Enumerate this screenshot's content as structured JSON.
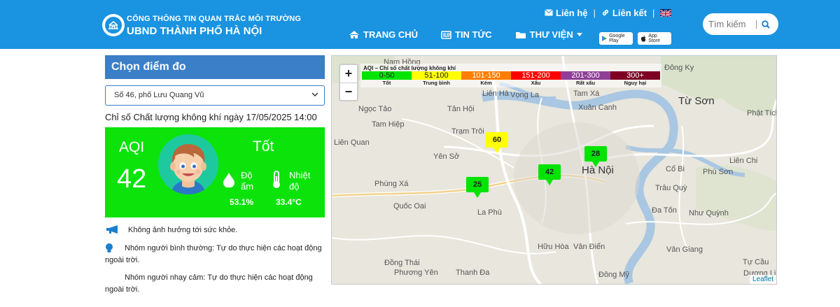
{
  "header": {
    "brand_top": "CỔNG THÔNG TIN QUAN TRẮC MÔI TRƯỜNG",
    "brand_main": "UBND THÀNH PHỐ HÀ NỘI",
    "contact": "Liên hệ",
    "links": "Liên kết",
    "nav": [
      {
        "label": "TRANG CHỦ",
        "icon": "home-icon"
      },
      {
        "label": "TIN TỨC",
        "icon": "newspaper-icon"
      },
      {
        "label": "THƯ VIỆN",
        "icon": "folder-icon"
      }
    ],
    "google_play": "Google Play",
    "app_store": "App Store",
    "search_placeholder": "Tìm kiếm",
    "color": "#1a93e0"
  },
  "panel": {
    "title": "Chọn điểm đo",
    "station": "Số 46, phố Lưu Quang Vũ",
    "date_line": "Chỉ số Chất lượng không khí ngày 17/05/2025 14:00",
    "aqi_label": "AQI",
    "aqi_value": "42",
    "aqi_status": "Tốt",
    "aqi_color": "#0be30b",
    "humidity_label": [
      "Độ",
      "ẩm"
    ],
    "humidity_value": "53.1%",
    "temp_label": [
      "Nhiệt",
      "độ"
    ],
    "temp_value": "33.4°C",
    "advice": [
      "Không ảnh hưởng tới sức khỏe.",
      "Nhóm người bình thường: Tự do thực hiện các hoạt động ngoài trời.",
      "Nhóm người nhạy cảm: Tự do thực hiện các hoạt động ngoài trời."
    ]
  },
  "map": {
    "legend_title": "AQI – Chỉ số chất lượng không khí",
    "legend": [
      {
        "range": "0-50",
        "label": "Tốt",
        "color": "#00e400",
        "text": "#222"
      },
      {
        "range": "51-100",
        "label": "Trung bình",
        "color": "#ffff00",
        "text": "#222"
      },
      {
        "range": "101-150",
        "label": "Kém",
        "color": "#ff7e00",
        "text": "#fff"
      },
      {
        "range": "151-200",
        "label": "Xấu",
        "color": "#ff0000",
        "text": "#fff"
      },
      {
        "range": "201-300",
        "label": "Rất xấu",
        "color": "#8f3f97",
        "text": "#fff"
      },
      {
        "range": "300+",
        "label": "Nguy hại",
        "color": "#7e0023",
        "text": "#fff"
      }
    ],
    "markers": [
      {
        "value": "60",
        "color": "#ffff00"
      },
      {
        "value": "28",
        "color": "#00e400"
      },
      {
        "value": "42",
        "color": "#00e400"
      },
      {
        "value": "25",
        "color": "#00e400"
      }
    ],
    "places": [
      "Nam Hồng",
      "Đông Ky",
      "Liên Hà",
      "Vọng La",
      "Tam Xá",
      "Ngọc Tảo",
      "Tân Hội",
      "Xuân Canh",
      "Từ Sơn",
      "Phật Tích",
      "Tam Hiệp",
      "Trạm Trôi",
      "Liên Quan",
      "Yên Sở",
      "Hà Nội",
      "Cổ Bi",
      "Liên Chi",
      "Phù Sơn",
      "Phùng Xá",
      "Trâu Quỳ",
      "Quốc Oai",
      "La Phù",
      "Đa Tốn",
      "Như Quỳnh",
      "Hữu Hòa",
      "Vân Điển",
      "Vân Giang",
      "Phương Yên",
      "Đông Mỹ",
      "Tự Cầu",
      "Đồng Thái",
      "Thanh Đa",
      "Dương Liễu"
    ],
    "zoom_in": "+",
    "zoom_out": "−",
    "attribution": "Leaflet"
  }
}
